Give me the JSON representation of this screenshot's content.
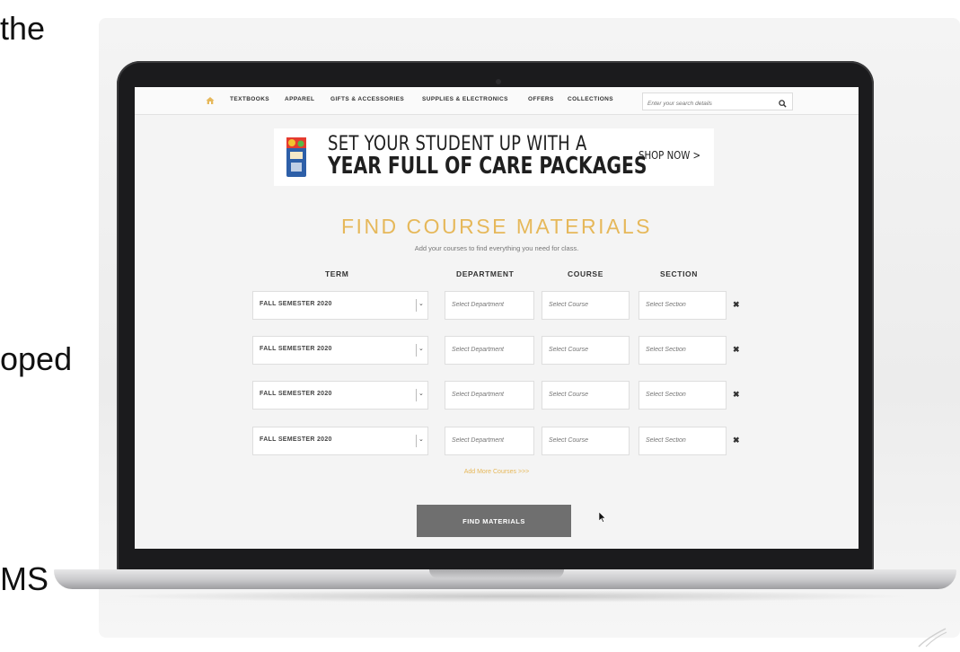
{
  "slide_fragments": [
    "the",
    "oped",
    "MS"
  ],
  "nav": {
    "home_icon": "home-icon",
    "items": [
      "TEXTBOOKS",
      "APPAREL",
      "GIFTS & ACCESSORIES",
      "SUPPLIES & ELECTRONICS",
      "OFFERS",
      "COLLECTIONS"
    ],
    "search_placeholder": "Enter your search details",
    "search_icon": "magnifier-icon"
  },
  "banner": {
    "line1": "SET YOUR STUDENT UP WITH A",
    "line2": "YEAR FULL OF CARE PACKAGES",
    "cta": "SHOP NOW >"
  },
  "finder": {
    "title": "FIND COURSE MATERIALS",
    "subtitle": "Add your courses to find everything you need for class.",
    "columns": {
      "term": "TERM",
      "department": "DEPARTMENT",
      "course": "COURSE",
      "section": "SECTION"
    },
    "rows": [
      {
        "term": "FALL SEMESTER 2020",
        "department_placeholder": "Select Department",
        "course_placeholder": "Select Course",
        "section_placeholder": "Select Section"
      },
      {
        "term": "FALL SEMESTER 2020",
        "department_placeholder": "Select Department",
        "course_placeholder": "Select Course",
        "section_placeholder": "Select Section"
      },
      {
        "term": "FALL SEMESTER 2020",
        "department_placeholder": "Select Department",
        "course_placeholder": "Select Course",
        "section_placeholder": "Select Section"
      },
      {
        "term": "FALL SEMESTER 2020",
        "department_placeholder": "Select Department",
        "course_placeholder": "Select Course",
        "section_placeholder": "Select Section"
      }
    ],
    "chevron_glyph": "⌄",
    "remove_glyph": "✖",
    "add_more": "Add More Courses >>>",
    "find_button": "FIND MATERIALS"
  },
  "colors": {
    "accent": "#e6b85a",
    "button": "#6f6f6f",
    "laptop_bezel": "#1b1b1d"
  }
}
